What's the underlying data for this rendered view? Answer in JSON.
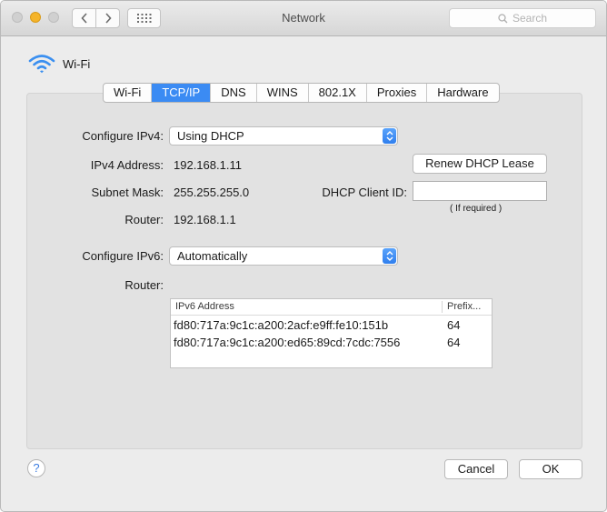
{
  "window": {
    "title": "Network"
  },
  "toolbar": {
    "search_placeholder": "Search"
  },
  "interface": {
    "name": "Wi-Fi"
  },
  "tabs": [
    {
      "label": "Wi-Fi"
    },
    {
      "label": "TCP/IP"
    },
    {
      "label": "DNS"
    },
    {
      "label": "WINS"
    },
    {
      "label": "802.1X"
    },
    {
      "label": "Proxies"
    },
    {
      "label": "Hardware"
    }
  ],
  "active_tab": "TCP/IP",
  "ipv4": {
    "configure_label": "Configure IPv4:",
    "configure_value": "Using DHCP",
    "address_label": "IPv4 Address:",
    "address_value": "192.168.1.11",
    "subnet_label": "Subnet Mask:",
    "subnet_value": "255.255.255.0",
    "router_label": "Router:",
    "router_value": "192.168.1.1",
    "renew_button": "Renew DHCP Lease",
    "client_id_label": "DHCP Client ID:",
    "client_id_value": "",
    "client_id_hint": "( If required )"
  },
  "ipv6": {
    "configure_label": "Configure IPv6:",
    "configure_value": "Automatically",
    "router_label": "Router:",
    "table": {
      "columns": [
        "IPv6 Address",
        "Prefix..."
      ],
      "rows": [
        {
          "address": "fd80:717a:9c1c:a200:2acf:e9ff:fe10:151b",
          "prefix": "64"
        },
        {
          "address": "fd80:717a:9c1c:a200:ed65:89cd:7cdc:7556",
          "prefix": "64"
        }
      ]
    }
  },
  "footer": {
    "help_label": "?",
    "cancel_label": "Cancel",
    "ok_label": "OK"
  },
  "colors": {
    "accent": "#3b8bf3",
    "minimize_light": "#f5b42a"
  }
}
